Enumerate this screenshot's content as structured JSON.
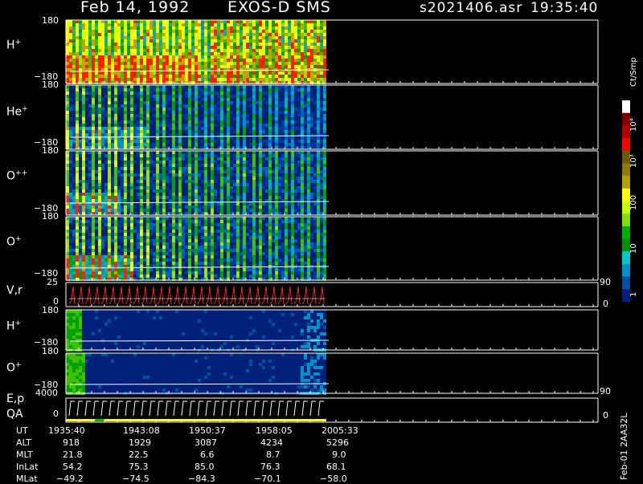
{
  "header": {
    "date": "Feb 14, 1992",
    "mission": "EXOS-D SMS",
    "file": "s2021406.asr",
    "time": "19:35:40"
  },
  "panels": [
    {
      "name": "H",
      "sup": "+",
      "ymax": "180",
      "ymin": "−180"
    },
    {
      "name": "He",
      "sup": "+",
      "ymax": "180",
      "ymin": "−180"
    },
    {
      "name": "O",
      "sup": "++",
      "ymax": "180",
      "ymin": "−180"
    },
    {
      "name": "O",
      "sup": "+",
      "ymax": "180",
      "ymin": "−180"
    },
    {
      "name": "V,r",
      "sup": "",
      "ymax": "25",
      "ymin": "0",
      "rmax": "90",
      "rmin": "0"
    },
    {
      "name": "H",
      "sup": "+",
      "ymax": "180",
      "ymin": "−180"
    },
    {
      "name": "O",
      "sup": "+",
      "ymax": "180",
      "ymin": "−180"
    },
    {
      "name": "E,p",
      "name2": "QA",
      "sup": "",
      "ymax": "4000",
      "ymin": "0",
      "rmax": "90",
      "rmin": "0"
    }
  ],
  "colorbar": {
    "unit": "Ct/Smp",
    "labels": [
      "10⁴",
      "10³",
      "100",
      "10",
      "1"
    ],
    "colors": [
      "#ffffff",
      "#7a0000",
      "#b00000",
      "#ff0000",
      "#6b5a00",
      "#8f7a00",
      "#b0a000",
      "#ffff00",
      "#c8ff00",
      "#80e000",
      "#00b000",
      "#009000",
      "#00c8c8",
      "#0090c8",
      "#0050a0",
      "#00207a"
    ]
  },
  "footer": {
    "rows": [
      {
        "label": "UT",
        "values": [
          "1935:40",
          "1943:08",
          "1950:37",
          "1958:05",
          "2005:33"
        ]
      },
      {
        "label": "ALT",
        "values": [
          "918",
          "1929",
          "3087",
          "4234",
          "5296"
        ]
      },
      {
        "label": "MLT",
        "values": [
          "21.8",
          "22.5",
          "6.6",
          "8.7",
          "9.0"
        ]
      },
      {
        "label": "InLat",
        "values": [
          "54.2",
          "75.3",
          "85.0",
          "76.3",
          "68.1"
        ]
      },
      {
        "label": "MLat",
        "values": [
          "−49.2",
          "−74.5",
          "−84.3",
          "−70.1",
          "−58.0"
        ]
      }
    ],
    "stamp": "Feb-01 2AA32L"
  },
  "chart_data": {
    "type": "heatmap",
    "title": "Feb 14, 1992   EXOS-D SMS",
    "x_tick_labels": [
      "1935:40",
      "1943:08",
      "1950:37",
      "1958:05",
      "2005:33"
    ],
    "series": [
      {
        "name": "H+",
        "ylim": [
          -180,
          180
        ]
      },
      {
        "name": "He+",
        "ylim": [
          -180,
          180
        ]
      },
      {
        "name": "O++",
        "ylim": [
          -180,
          180
        ]
      },
      {
        "name": "O+",
        "ylim": [
          -180,
          180
        ]
      },
      {
        "name": "V,r",
        "ylim": [
          0,
          25
        ],
        "right_ylim": [
          0,
          90
        ]
      },
      {
        "name": "H+",
        "ylim": [
          -180,
          180
        ]
      },
      {
        "name": "O+",
        "ylim": [
          -180,
          180
        ]
      },
      {
        "name": "E,p",
        "ylim": [
          0,
          4000
        ],
        "right_ylim": [
          0,
          90
        ]
      }
    ],
    "colorbar_unit": "Ct/Smp",
    "colorbar_ticks": [
      "1",
      "10",
      "100",
      "10³",
      "10⁴"
    ],
    "data_coverage_fraction": 0.49
  }
}
